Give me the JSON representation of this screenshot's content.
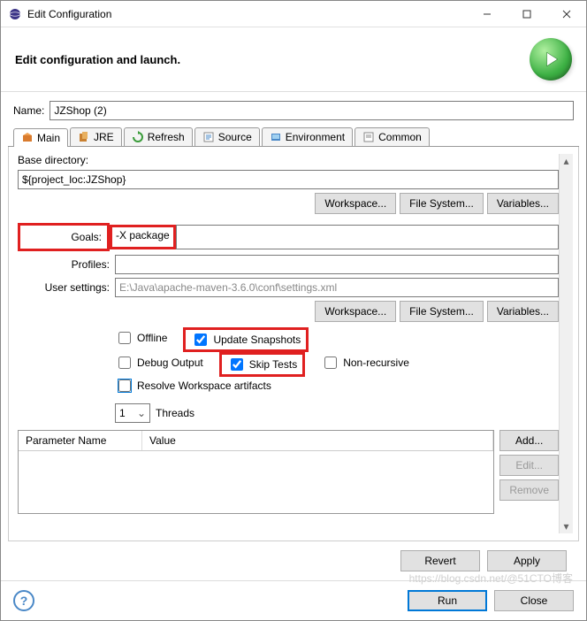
{
  "window": {
    "title": "Edit Configuration"
  },
  "banner": {
    "text": "Edit configuration and launch."
  },
  "name": {
    "label": "Name:",
    "value": "JZShop (2)"
  },
  "tabs": [
    {
      "label": "Main"
    },
    {
      "label": "JRE"
    },
    {
      "label": "Refresh"
    },
    {
      "label": "Source"
    },
    {
      "label": "Environment"
    },
    {
      "label": "Common"
    }
  ],
  "main": {
    "baseDirLabel": "Base directory:",
    "baseDir": "${project_loc:JZShop}",
    "buttons": {
      "workspace": "Workspace...",
      "filesystem": "File System...",
      "variables": "Variables..."
    },
    "goalsLabel": "Goals:",
    "goals": "-X package",
    "profilesLabel": "Profiles:",
    "profiles": "",
    "userSettingsLabel": "User settings:",
    "userSettings": "E:\\Java\\apache-maven-3.6.0\\conf\\settings.xml",
    "checks": {
      "offline": {
        "label": "Offline",
        "checked": false
      },
      "updateSnapshots": {
        "label": "Update Snapshots",
        "checked": true
      },
      "debugOutput": {
        "label": "Debug Output",
        "checked": false
      },
      "skipTests": {
        "label": "Skip Tests",
        "checked": true
      },
      "nonRecursive": {
        "label": "Non-recursive",
        "checked": false
      },
      "resolveWorkspace": {
        "label": "Resolve Workspace artifacts",
        "checked": false
      }
    },
    "threads": {
      "value": "1",
      "label": "Threads"
    },
    "table": {
      "columns": [
        "Parameter Name",
        "Value"
      ],
      "sideButtons": {
        "add": "Add...",
        "edit": "Edit...",
        "remove": "Remove"
      }
    }
  },
  "footer": {
    "revert": "Revert",
    "apply": "Apply",
    "run": "Run",
    "close": "Close"
  },
  "watermark": "https://blog.csdn.net/@51CTO博客"
}
